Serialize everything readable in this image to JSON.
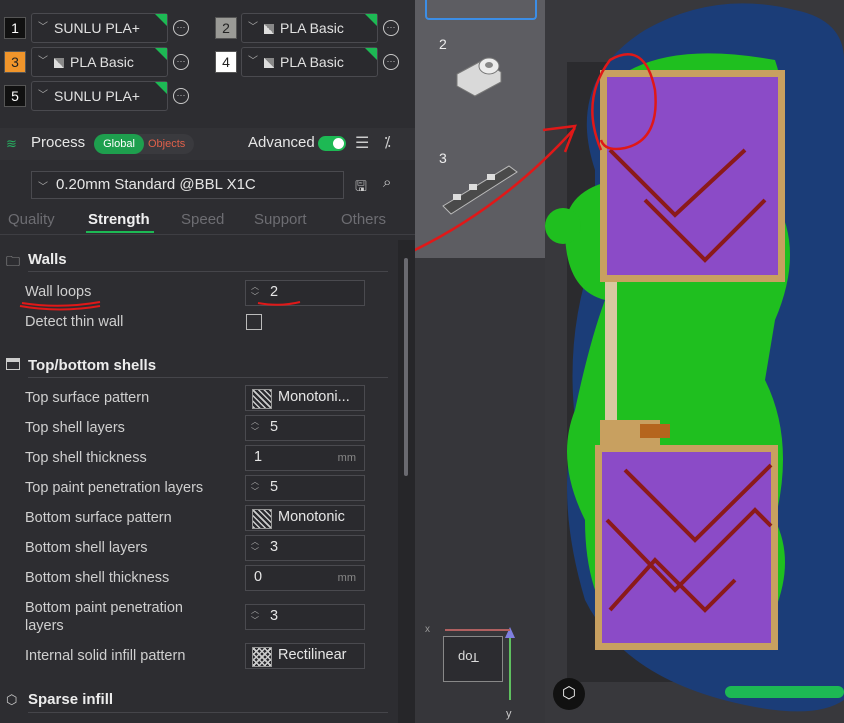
{
  "filaments": [
    {
      "num": "1",
      "name": "SUNLU PLA+",
      "color": "#111111",
      "icon": false
    },
    {
      "num": "2",
      "name": "PLA Basic",
      "color": "#9a9a96",
      "icon": true
    },
    {
      "num": "3",
      "name": "PLA Basic",
      "color": "#f0952b",
      "icon": true
    },
    {
      "num": "4",
      "name": "PLA Basic",
      "color": "#ffffff",
      "icon": true
    },
    {
      "num": "5",
      "name": "SUNLU PLA+",
      "color": "#111111",
      "icon": false
    }
  ],
  "process": {
    "title": "Process",
    "global": "Global",
    "objects": "Objects",
    "advanced": "Advanced",
    "preset": "0.20mm Standard @BBL X1C"
  },
  "tabs": [
    "Quality",
    "Strength",
    "Speed",
    "Support",
    "Others"
  ],
  "walls": {
    "title": "Walls",
    "wall_loops_label": "Wall loops",
    "wall_loops_value": "2",
    "detect_thin_wall_label": "Detect thin wall"
  },
  "shells": {
    "title": "Top/bottom shells",
    "top_surface_pattern_label": "Top surface pattern",
    "top_surface_pattern_value": "Monotoni...",
    "top_shell_layers_label": "Top shell layers",
    "top_shell_layers_value": "5",
    "top_shell_thickness_label": "Top shell thickness",
    "top_shell_thickness_value": "1",
    "mm": "mm",
    "top_paint_label": "Top paint penetration layers",
    "top_paint_value": "5",
    "bottom_surface_pattern_label": "Bottom surface pattern",
    "bottom_surface_pattern_value": "Monotonic",
    "bottom_shell_layers_label": "Bottom shell layers",
    "bottom_shell_layers_value": "3",
    "bottom_shell_thickness_label": "Bottom shell thickness",
    "bottom_shell_thickness_value": "0",
    "bottom_paint_label_1": "Bottom paint penetration",
    "bottom_paint_label_2": "layers",
    "bottom_paint_value": "3",
    "internal_solid_label": "Internal solid infill pattern",
    "internal_solid_value": "Rectilinear"
  },
  "sparse": {
    "title": "Sparse infill"
  },
  "plates": {
    "p2": "2",
    "p3": "3"
  },
  "axes": {
    "x": "x",
    "y": "y",
    "top": "Top"
  }
}
